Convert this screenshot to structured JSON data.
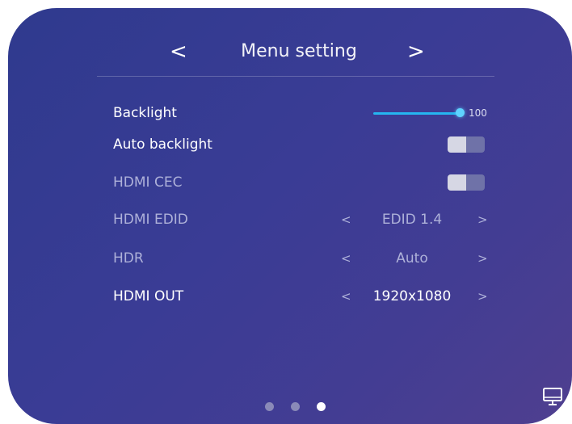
{
  "header": {
    "prev_glyph": "<",
    "title": "Menu setting",
    "next_glyph": ">"
  },
  "settings": {
    "backlight": {
      "label": "Backlight",
      "value": "100",
      "level": 100
    },
    "auto_backlight": {
      "label": "Auto backlight",
      "state": "on"
    },
    "hdmi_cec": {
      "label": "HDMI CEC",
      "state": "on"
    },
    "hdmi_edid": {
      "label": "HDMI EDID",
      "prev_glyph": "<",
      "value": "EDID 1.4",
      "next_glyph": ">"
    },
    "hdr": {
      "label": "HDR",
      "prev_glyph": "<",
      "value": "Auto",
      "next_glyph": ">"
    },
    "hdmi_out": {
      "label": "HDMI OUT",
      "prev_glyph": "<",
      "value": "1920x1080",
      "next_glyph": ">"
    }
  },
  "pagination": {
    "total": 3,
    "current": 3
  },
  "icons": {
    "display": "monitor-icon"
  },
  "colors": {
    "accent": "#25b6f0",
    "background_start": "#2f3a8e",
    "background_end": "#4f3f8f",
    "dim_text": "#aeb1d9"
  }
}
